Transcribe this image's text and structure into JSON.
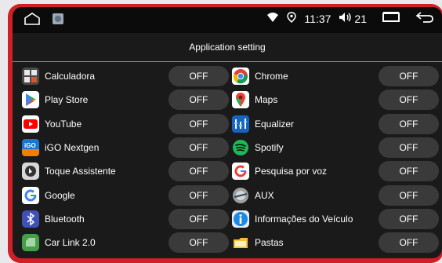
{
  "status": {
    "time": "11:37",
    "volume": "21",
    "icons": [
      "home-icon",
      "gallery-icon",
      "wifi-icon",
      "location-icon",
      "volume-icon",
      "recent-apps-icon",
      "back-icon"
    ]
  },
  "title": "Application setting",
  "apps": [
    {
      "name": "Calculadora",
      "state": "OFF",
      "icon": "calculator-icon"
    },
    {
      "name": "Chrome",
      "state": "OFF",
      "icon": "chrome-icon"
    },
    {
      "name": "Play Store",
      "state": "OFF",
      "icon": "play-store-icon"
    },
    {
      "name": "Maps",
      "state": "OFF",
      "icon": "maps-icon"
    },
    {
      "name": "YouTube",
      "state": "OFF",
      "icon": "youtube-icon"
    },
    {
      "name": "Equalizer",
      "state": "OFF",
      "icon": "equalizer-icon"
    },
    {
      "name": "iGO Nextgen",
      "state": "OFF",
      "icon": "igo-icon"
    },
    {
      "name": "Spotify",
      "state": "OFF",
      "icon": "spotify-icon"
    },
    {
      "name": "Toque Assistente",
      "state": "OFF",
      "icon": "touch-assistant-icon"
    },
    {
      "name": "Pesquisa por voz",
      "state": "OFF",
      "icon": "voice-search-icon"
    },
    {
      "name": "Google",
      "state": "OFF",
      "icon": "google-icon"
    },
    {
      "name": "AUX",
      "state": "OFF",
      "icon": "aux-icon"
    },
    {
      "name": "Bluetooth",
      "state": "OFF",
      "icon": "bluetooth-icon"
    },
    {
      "name": "Informações do Veículo",
      "state": "OFF",
      "icon": "vehicle-info-icon"
    },
    {
      "name": "Car Link 2.0",
      "state": "OFF",
      "icon": "car-link-icon"
    },
    {
      "name": "Pastas",
      "state": "OFF",
      "icon": "folders-icon"
    }
  ]
}
